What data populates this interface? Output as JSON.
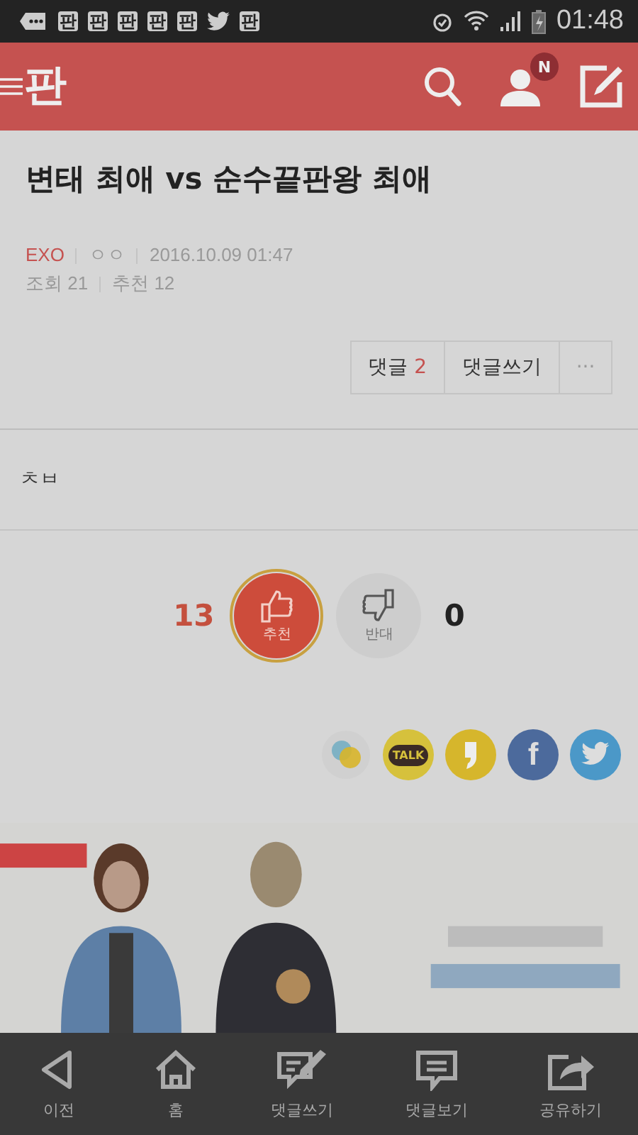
{
  "status_bar": {
    "notifications": [
      {
        "kind": "chat"
      },
      {
        "kind": "app",
        "label": "판"
      },
      {
        "kind": "app",
        "label": "판"
      },
      {
        "kind": "app",
        "label": "판"
      },
      {
        "kind": "app",
        "label": "판"
      },
      {
        "kind": "app",
        "label": "판"
      },
      {
        "kind": "twitter"
      },
      {
        "kind": "app",
        "label": "판"
      }
    ],
    "time": "01:48"
  },
  "header": {
    "logo": "판",
    "badge": "N"
  },
  "post": {
    "title": "변태 최애 vs 순수끝판왕 최애",
    "category": "EXO",
    "author": "ㅇㅇ",
    "date": "2016.10.09 01:47",
    "views_label": "조회 21",
    "likes_label": "추천 12",
    "comment_label": "댓글",
    "comment_count": "2",
    "write_comment": "댓글쓰기",
    "more": "···",
    "body": "ㅊㅂ"
  },
  "vote": {
    "up_count": "13",
    "up_label": "추천",
    "up_selected": true,
    "down_label": "반대",
    "down_count": "0",
    "down_selected": false
  },
  "share": [
    {
      "kind": "chat"
    },
    {
      "kind": "talk",
      "label": "TALK"
    },
    {
      "kind": "story"
    },
    {
      "kind": "facebook",
      "label": "f"
    },
    {
      "kind": "twitter"
    }
  ],
  "bottom_nav": [
    {
      "kind": "back",
      "label": "이전"
    },
    {
      "kind": "home",
      "label": "홈"
    },
    {
      "kind": "write",
      "label": "댓글쓰기"
    },
    {
      "kind": "view",
      "label": "댓글보기"
    },
    {
      "kind": "share",
      "label": "공유하기"
    }
  ]
}
